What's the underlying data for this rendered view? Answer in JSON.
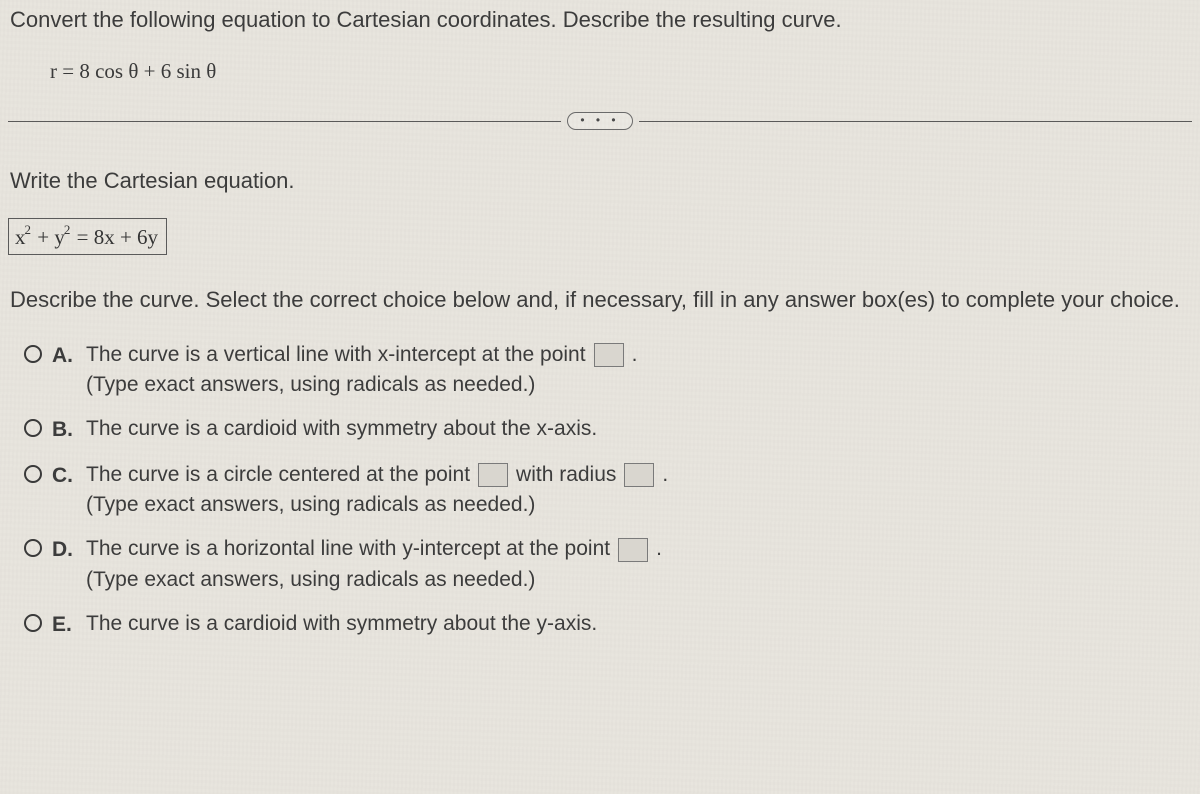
{
  "question": {
    "title": "Convert the following equation to Cartesian coordinates. Describe the resulting curve.",
    "polar_equation": "r = 8 cos θ + 6 sin θ"
  },
  "divider_dots": "• • •",
  "prompts": {
    "write_cartesian": "Write the Cartesian equation.",
    "describe": "Describe the curve. Select the correct choice below and, if necessary, fill in any answer box(es) to complete your choice."
  },
  "cartesian_answer": {
    "lhs_x_base": "x",
    "lhs_x_exp": "2",
    "lhs_plus": " + ",
    "lhs_y_base": "y",
    "lhs_y_exp": "2",
    "eq": " = ",
    "rhs": "8x + 6y"
  },
  "options": {
    "A": {
      "letter": "A.",
      "line1_pre": "The curve is a vertical line with x-intercept at the point",
      "line1_post": ".",
      "sub": "(Type exact answers, using radicals as needed.)"
    },
    "B": {
      "letter": "B.",
      "line1": "The curve is a cardioid with symmetry about the x-axis."
    },
    "C": {
      "letter": "C.",
      "line1_pre": "The curve is a circle centered at the point",
      "line1_mid": "with radius",
      "line1_post": ".",
      "sub": "(Type exact answers, using radicals as needed.)"
    },
    "D": {
      "letter": "D.",
      "line1_pre": "The curve is a horizontal line with y-intercept at the point",
      "line1_post": ".",
      "sub": "(Type exact answers, using radicals as needed.)"
    },
    "E": {
      "letter": "E.",
      "line1": "The curve is a cardioid with symmetry about the y-axis."
    }
  }
}
